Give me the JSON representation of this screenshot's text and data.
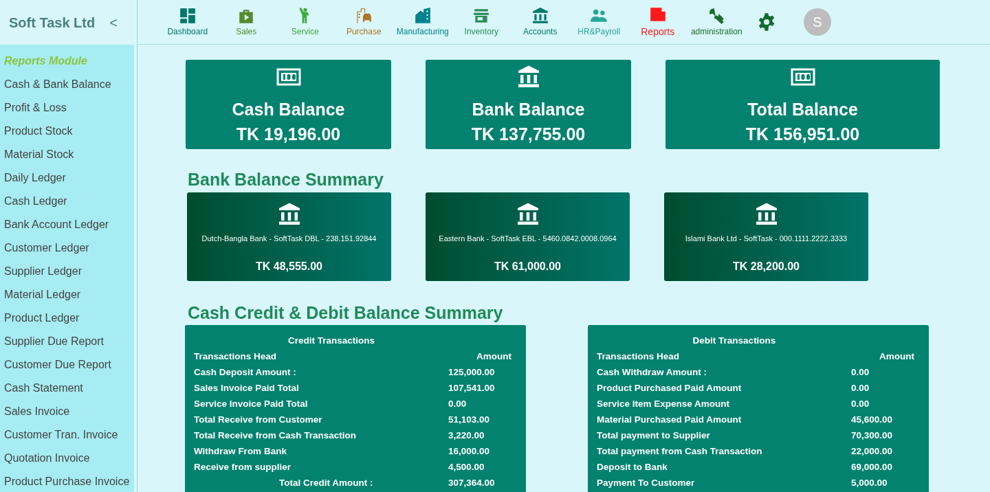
{
  "sidebar": {
    "title": "Soft Task Ltd",
    "collapse": "<",
    "section": "Reports Module",
    "items": [
      "Cash & Bank Balance",
      "Profit & Loss",
      "Product Stock",
      "Material Stock",
      "Daily Ledger",
      "Cash Ledger",
      "Bank Account Ledger",
      "Customer Ledger",
      "Supplier Ledger",
      "Material Ledger",
      "Product Ledger",
      "Supplier Due Report",
      "Customer Due Report",
      "Cash Statement",
      "Sales Invoice",
      "Customer Tran. Invoice",
      "Quotation Invoice",
      "Product Purchase Invoice"
    ]
  },
  "nav": [
    {
      "label": "Dashboard",
      "color": "#00796b",
      "selected": false
    },
    {
      "label": "Sales",
      "color": "#558b2f",
      "selected": false
    },
    {
      "label": "Service",
      "color": "#3ea83a",
      "selected": false
    },
    {
      "label": "Purchase",
      "color": "#b07424",
      "selected": false
    },
    {
      "label": "Manufacturing",
      "color": "#00838f",
      "selected": false
    },
    {
      "label": "Inventory",
      "color": "#2e8b57",
      "selected": false
    },
    {
      "label": "Accounts",
      "color": "#00796b",
      "selected": false
    },
    {
      "label": "HR&Payroll",
      "color": "#26a69a",
      "selected": false
    },
    {
      "label": "Reports",
      "color": "#ff1a1a",
      "selected": true
    },
    {
      "label": "administration",
      "color": "#1b6e2a",
      "selected": false
    }
  ],
  "avatar": "S",
  "balances": [
    {
      "title": "Cash Balance",
      "amount": "TK 19,196.00",
      "kind": "cash"
    },
    {
      "title": "Bank Balance",
      "amount": "TK 137,755.00",
      "kind": "bank"
    },
    {
      "title": "Total Balance",
      "amount": "TK 156,951.00",
      "kind": "cash"
    }
  ],
  "bank_summary": {
    "heading": "Bank Balance Summary",
    "banks": [
      {
        "name": "Dutch-Bangla Bank - SoftTask DBL - 238.151.92844",
        "amount": "TK 48,555.00"
      },
      {
        "name": "Eastern Bank - SoftTask EBL - 5460.0842.0008.0964",
        "amount": "TK 61,000.00"
      },
      {
        "name": "Islami Bank Ltd - SoftTask - 000.1111.2222.3333",
        "amount": "TK 28,200.00"
      }
    ]
  },
  "cash_summary": {
    "heading": "Cash Credit & Debit Balance Summary",
    "tables": [
      {
        "title": "Credit Transactions",
        "columns": [
          "Transactions Head",
          "Amount"
        ],
        "rows": [
          [
            "Cash Deposit Amount :",
            "125,000.00"
          ],
          [
            "Sales Invoice Paid Total",
            "107,541.00"
          ],
          [
            "Service Invoice Paid Total",
            "0.00"
          ],
          [
            "Total Receive from Customer",
            "51,103.00"
          ],
          [
            "Total Receive from Cash Transaction",
            "3,220.00"
          ],
          [
            "Withdraw From Bank",
            "16,000.00"
          ],
          [
            "Receive from supplier",
            "4,500.00"
          ]
        ],
        "last_row": {
          "kind": "total",
          "cells": [
            "Total Credit Amount :",
            "307,364.00"
          ]
        }
      },
      {
        "title": "Debit Transactions",
        "columns": [
          "Transactions Head",
          "Amount"
        ],
        "rows": [
          [
            "Cash Withdraw Amount :",
            "0.00"
          ],
          [
            "Product Purchased Paid Amount",
            "0.00"
          ],
          [
            "Service Item Expense Amount",
            "0.00"
          ],
          [
            "Material Purchased Paid Amount",
            "45,600.00"
          ],
          [
            "Total payment to Supplier",
            "70,300.00"
          ],
          [
            "Total payment from Cash Transaction",
            "22,000.00"
          ],
          [
            "Deposit to Bank",
            "69,000.00"
          ]
        ],
        "last_row": {
          "kind": "row",
          "cells": [
            "Payment To Customer",
            "5,000.00"
          ]
        }
      }
    ]
  }
}
